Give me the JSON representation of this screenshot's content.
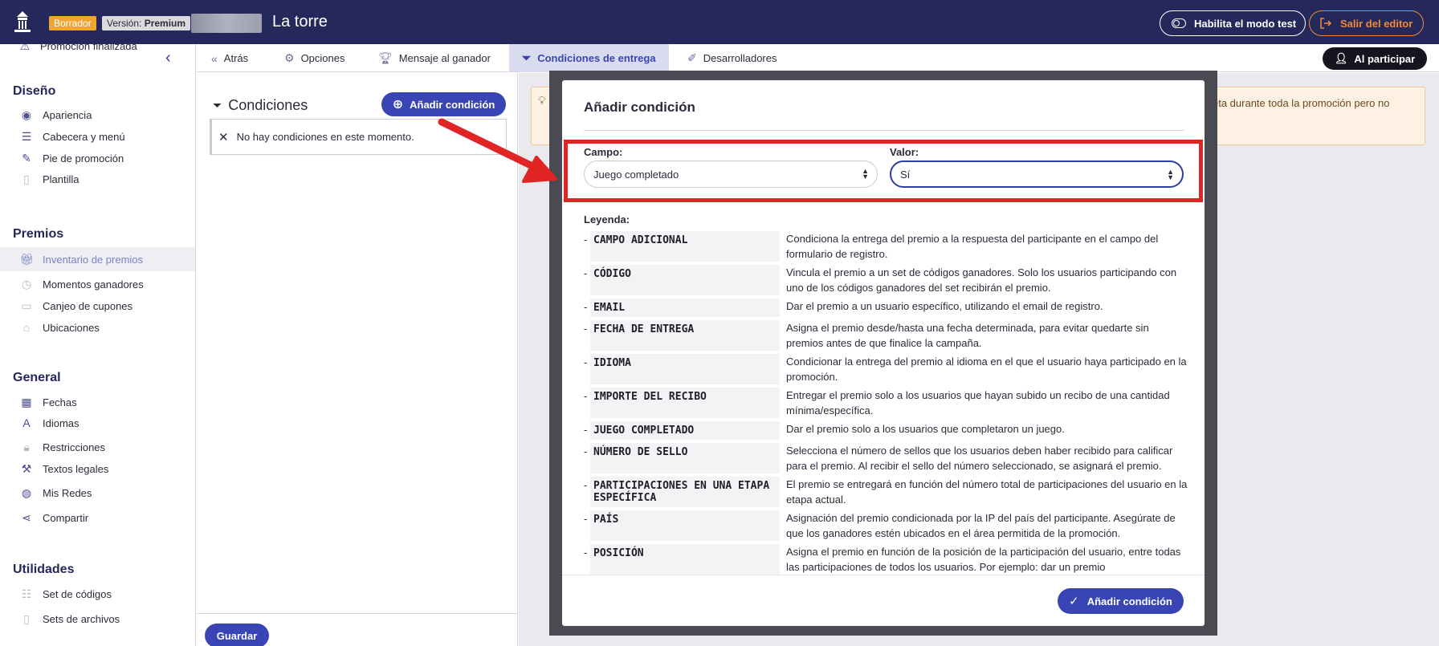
{
  "topbar": {
    "draft_badge": "Borrador",
    "version_prefix": "Versión:",
    "version_value": "Premium",
    "title": "La torre",
    "test_mode_button": "Habilita el modo test",
    "exit_button": "Salir del editor"
  },
  "sidebar": {
    "top_item": "Promoción finalizada",
    "sections": [
      {
        "title": "Diseño",
        "items": [
          {
            "label": "Apariencia",
            "icon": "palette-icon"
          },
          {
            "label": "Cabecera y menú",
            "icon": "menu-icon"
          },
          {
            "label": "Pie de promoción",
            "icon": "footprint-icon"
          },
          {
            "label": "Plantilla",
            "icon": "document-icon"
          }
        ]
      },
      {
        "title": "Premios",
        "items": [
          {
            "label": "Inventario de premios",
            "icon": "gift-icon",
            "active": true
          },
          {
            "label": "Momentos ganadores",
            "icon": "clock-icon"
          },
          {
            "label": "Canjeo de cupones",
            "icon": "coupon-icon"
          },
          {
            "label": "Ubicaciones",
            "icon": "store-icon"
          }
        ]
      },
      {
        "title": "General",
        "items": [
          {
            "label": "Fechas",
            "icon": "calendar-icon"
          },
          {
            "label": "Idiomas",
            "icon": "translate-icon"
          },
          {
            "label": "Restricciones",
            "icon": "lock-icon"
          },
          {
            "label": "Textos legales",
            "icon": "gavel-icon"
          },
          {
            "label": "Mis Redes",
            "icon": "globe-icon"
          },
          {
            "label": "Compartir",
            "icon": "share-icon"
          }
        ]
      },
      {
        "title": "Utilidades",
        "items": [
          {
            "label": "Set de códigos",
            "icon": "code-list-icon"
          },
          {
            "label": "Sets de archivos",
            "icon": "file-icon"
          }
        ]
      }
    ]
  },
  "nav": {
    "back": "Atrás",
    "options": "Opciones",
    "winner_message": "Mensaje al ganador",
    "delivery_conditions": "Condiciones de entrega",
    "developers": "Desarrolladores",
    "participate_button": "Al participar"
  },
  "conditions": {
    "title": "Condiciones",
    "add_button": "Añadir condición",
    "empty_message": "No hay condiciones en este momento.",
    "save_button": "Guardar"
  },
  "warning": {
    "text": "eta durante toda la promoción pero no"
  },
  "modal": {
    "title": "Añadir condición",
    "field_label": "Campo:",
    "field_value": "Juego completado",
    "value_label": "Valor:",
    "value_value": "Sí",
    "legend_title": "Leyenda:",
    "legend": [
      {
        "key": "CAMPO ADICIONAL",
        "desc": "Condiciona la entrega del premio a la respuesta del participante en el campo del formulario de registro."
      },
      {
        "key": "CÓDIGO",
        "desc": "Vincula el premio a un set de códigos ganadores. Solo los usuarios participando con uno de los códigos ganadores del set recibirán el premio."
      },
      {
        "key": "EMAIL",
        "desc": "Dar el premio a un usuario específico, utilizando el email de registro."
      },
      {
        "key": "FECHA DE ENTREGA",
        "desc": "Asigna el premio desde/hasta una fecha determinada, para evitar quedarte sin premios antes de que finalice la campaña."
      },
      {
        "key": "IDIOMA",
        "desc": "Condicionar la entrega del premio al idioma en el que el usuario haya participado en la promoción."
      },
      {
        "key": "IMPORTE DEL RECIBO",
        "desc": "Entregar el premio solo a los usuarios que hayan subido un recibo de una cantidad mínima/específica."
      },
      {
        "key": "JUEGO COMPLETADO",
        "desc": "Dar el premio solo a los usuarios que completaron un juego."
      },
      {
        "key": "NÚMERO DE SELLO",
        "desc": "Selecciona el número de sellos que los usuarios deben haber recibido para calificar para el premio. Al recibir el sello del número seleccionado, se asignará el premio."
      },
      {
        "key": "PARTICIPACIONES EN UNA ETAPA ESPECÍFICA",
        "desc": "El premio se entregará en función del número total de participaciones del usuario en la etapa actual."
      },
      {
        "key": "PAÍS",
        "desc": "Asignación del premio condicionada por la IP del país del participante. Asegúrate de que los ganadores estén ubicados en el área permitida de la promoción."
      },
      {
        "key": "POSICIÓN",
        "desc": "Asigna el premio en función de la posición de la participación del usuario, entre todas las participaciones de todos los usuarios. Por ejemplo: dar un premio"
      }
    ],
    "submit_button": "Añadir condición"
  }
}
